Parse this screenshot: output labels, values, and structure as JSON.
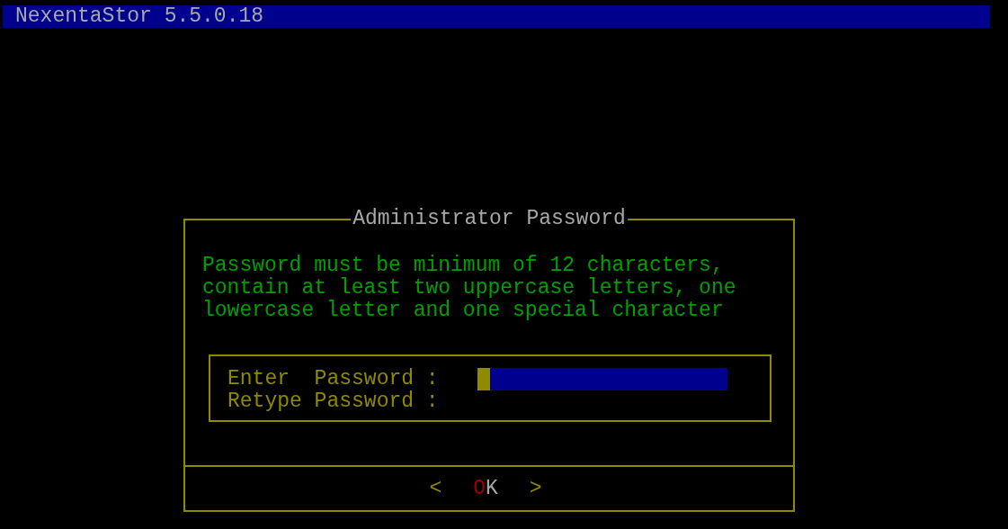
{
  "header": {
    "title": "NexentaStor 5.5.0.18"
  },
  "dialog": {
    "title": "Administrator Password",
    "message": [
      "Password must be minimum of 12 characters,",
      "contain at least two uppercase letters, one",
      "lowercase letter and one special character"
    ],
    "fields": [
      {
        "label": "Enter  Password :",
        "focused": true
      },
      {
        "label": "Retype Password :",
        "focused": false
      }
    ],
    "button": {
      "left": "<",
      "hotkey": "O",
      "label": "K",
      "right": ">"
    }
  }
}
